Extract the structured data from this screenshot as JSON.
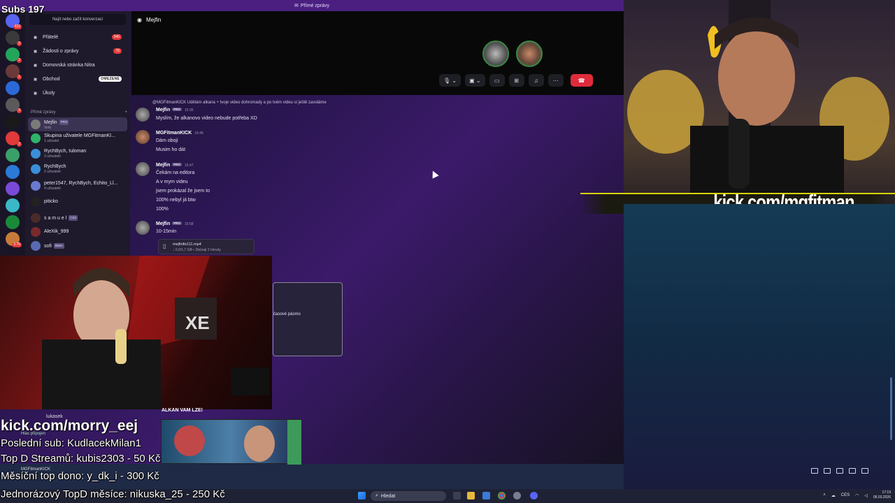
{
  "overlay": {
    "subs": "Subs 197",
    "kick_url_right": "kick.com/mgfitman",
    "kick_url_left": "kick.com/morry_eej",
    "last_sub": "Poslední sub: KudlacekMilan1",
    "top_stream": "Top D Streamů: kubis2303 - 50 Kč",
    "monthly_top": "Měsíční top dono: y_dk_i - 300 Kč",
    "one_time": "Jednorázový TopD měsíce: nikuska_25 - 250 Kč",
    "thumb_title": "ALKAN VAM LZE!"
  },
  "window": {
    "title": "Přímé zprávy"
  },
  "sidebar": {
    "search_placeholder": "Najít nebo začít konverzaci",
    "guild_badges": [
      "432",
      "3",
      "2",
      "1",
      "",
      "3",
      "",
      "2",
      "",
      "",
      "",
      "",
      "",
      "3.76"
    ],
    "nav": [
      {
        "label": "Přátelé",
        "badge": "346",
        "icon": "friends-icon"
      },
      {
        "label": "Žádosti o zprávy",
        "badge": "76",
        "icon": "inbox-icon"
      },
      {
        "label": "Domovská stránka Nitra",
        "badge": "",
        "icon": "nitro-icon"
      },
      {
        "label": "Obchod",
        "badge": "OMEZENÉ",
        "icon": "shop-icon"
      },
      {
        "label": "Úkoly",
        "badge": "",
        "icon": "quests-icon"
      }
    ],
    "dm_header": "Přímé zprávy",
    "dms": [
      {
        "name": "Mejfin",
        "sub": "Volá",
        "tag": "PRO",
        "color": "#7a7a7a"
      },
      {
        "name": "Skupina uživatele MGFitmanKI...",
        "sub": "1 uživatel",
        "tag": "",
        "color": "#2fb36a"
      },
      {
        "name": "RychBych, tuloman",
        "sub": "3 uživatelé",
        "tag": "",
        "color": "#3a8fd8"
      },
      {
        "name": "RychBych",
        "sub": "2 uživatelé",
        "tag": "",
        "color": "#3a8fd8"
      },
      {
        "name": "peter1547, RychBych, Echito_Ll...",
        "sub": "4 uživatelé",
        "tag": "",
        "color": "#6a7ad0"
      },
      {
        "name": "piticko",
        "sub": "",
        "tag": "",
        "color": "#222"
      },
      {
        "name": "s a m u e l",
        "sub": "",
        "tag": "CS2",
        "color": "#4a2a2a"
      },
      {
        "name": "AleXik_999",
        "sub": "",
        "tag": "",
        "color": "#7a2a2a"
      },
      {
        "name": "sofi",
        "sub": "",
        "tag": "kitten",
        "color": "#5a6ab0"
      }
    ],
    "voice_user": "lukasek",
    "voice_status": "Hlas připojen",
    "me": "MGFitmanKICK"
  },
  "call": {
    "name": "Mejfin"
  },
  "messages": [
    {
      "reply": "@MGFitmanKICK Udělám alkana + tvoje video dohromady a po tvém videu si ještě zavoláme",
      "author": "Mejfin",
      "tag": "PRO",
      "time": "15:35",
      "lines": [
        "Myslím, že alkanovo video nebude potřeba XD"
      ]
    },
    {
      "author": "MGFitmanKICK",
      "time": "15:46",
      "lines": [
        "Dám oboji",
        "Musim ho dát"
      ]
    },
    {
      "author": "Mejfin",
      "tag": "PRO",
      "time": "15:47",
      "lines": [
        "Čekám na editora",
        "A v mym videu",
        "jsem prokázal že jsem to",
        "100% nebyl já btw",
        "100%"
      ]
    },
    {
      "author": "Mejfin",
      "tag": "PRO",
      "time": "15:58",
      "lines": [
        "10-15min"
      ]
    }
  ],
  "attachment": {
    "name": "mejfinfix111.mp4",
    "size": "↓ 0,0/1,7 GB • Zbývají 2 minuty"
  },
  "popup_label": "časové pásmo",
  "taskbar": {
    "search": "Hledat",
    "lang": "CES",
    "time": "17:19",
    "date": "06.03.2026"
  }
}
